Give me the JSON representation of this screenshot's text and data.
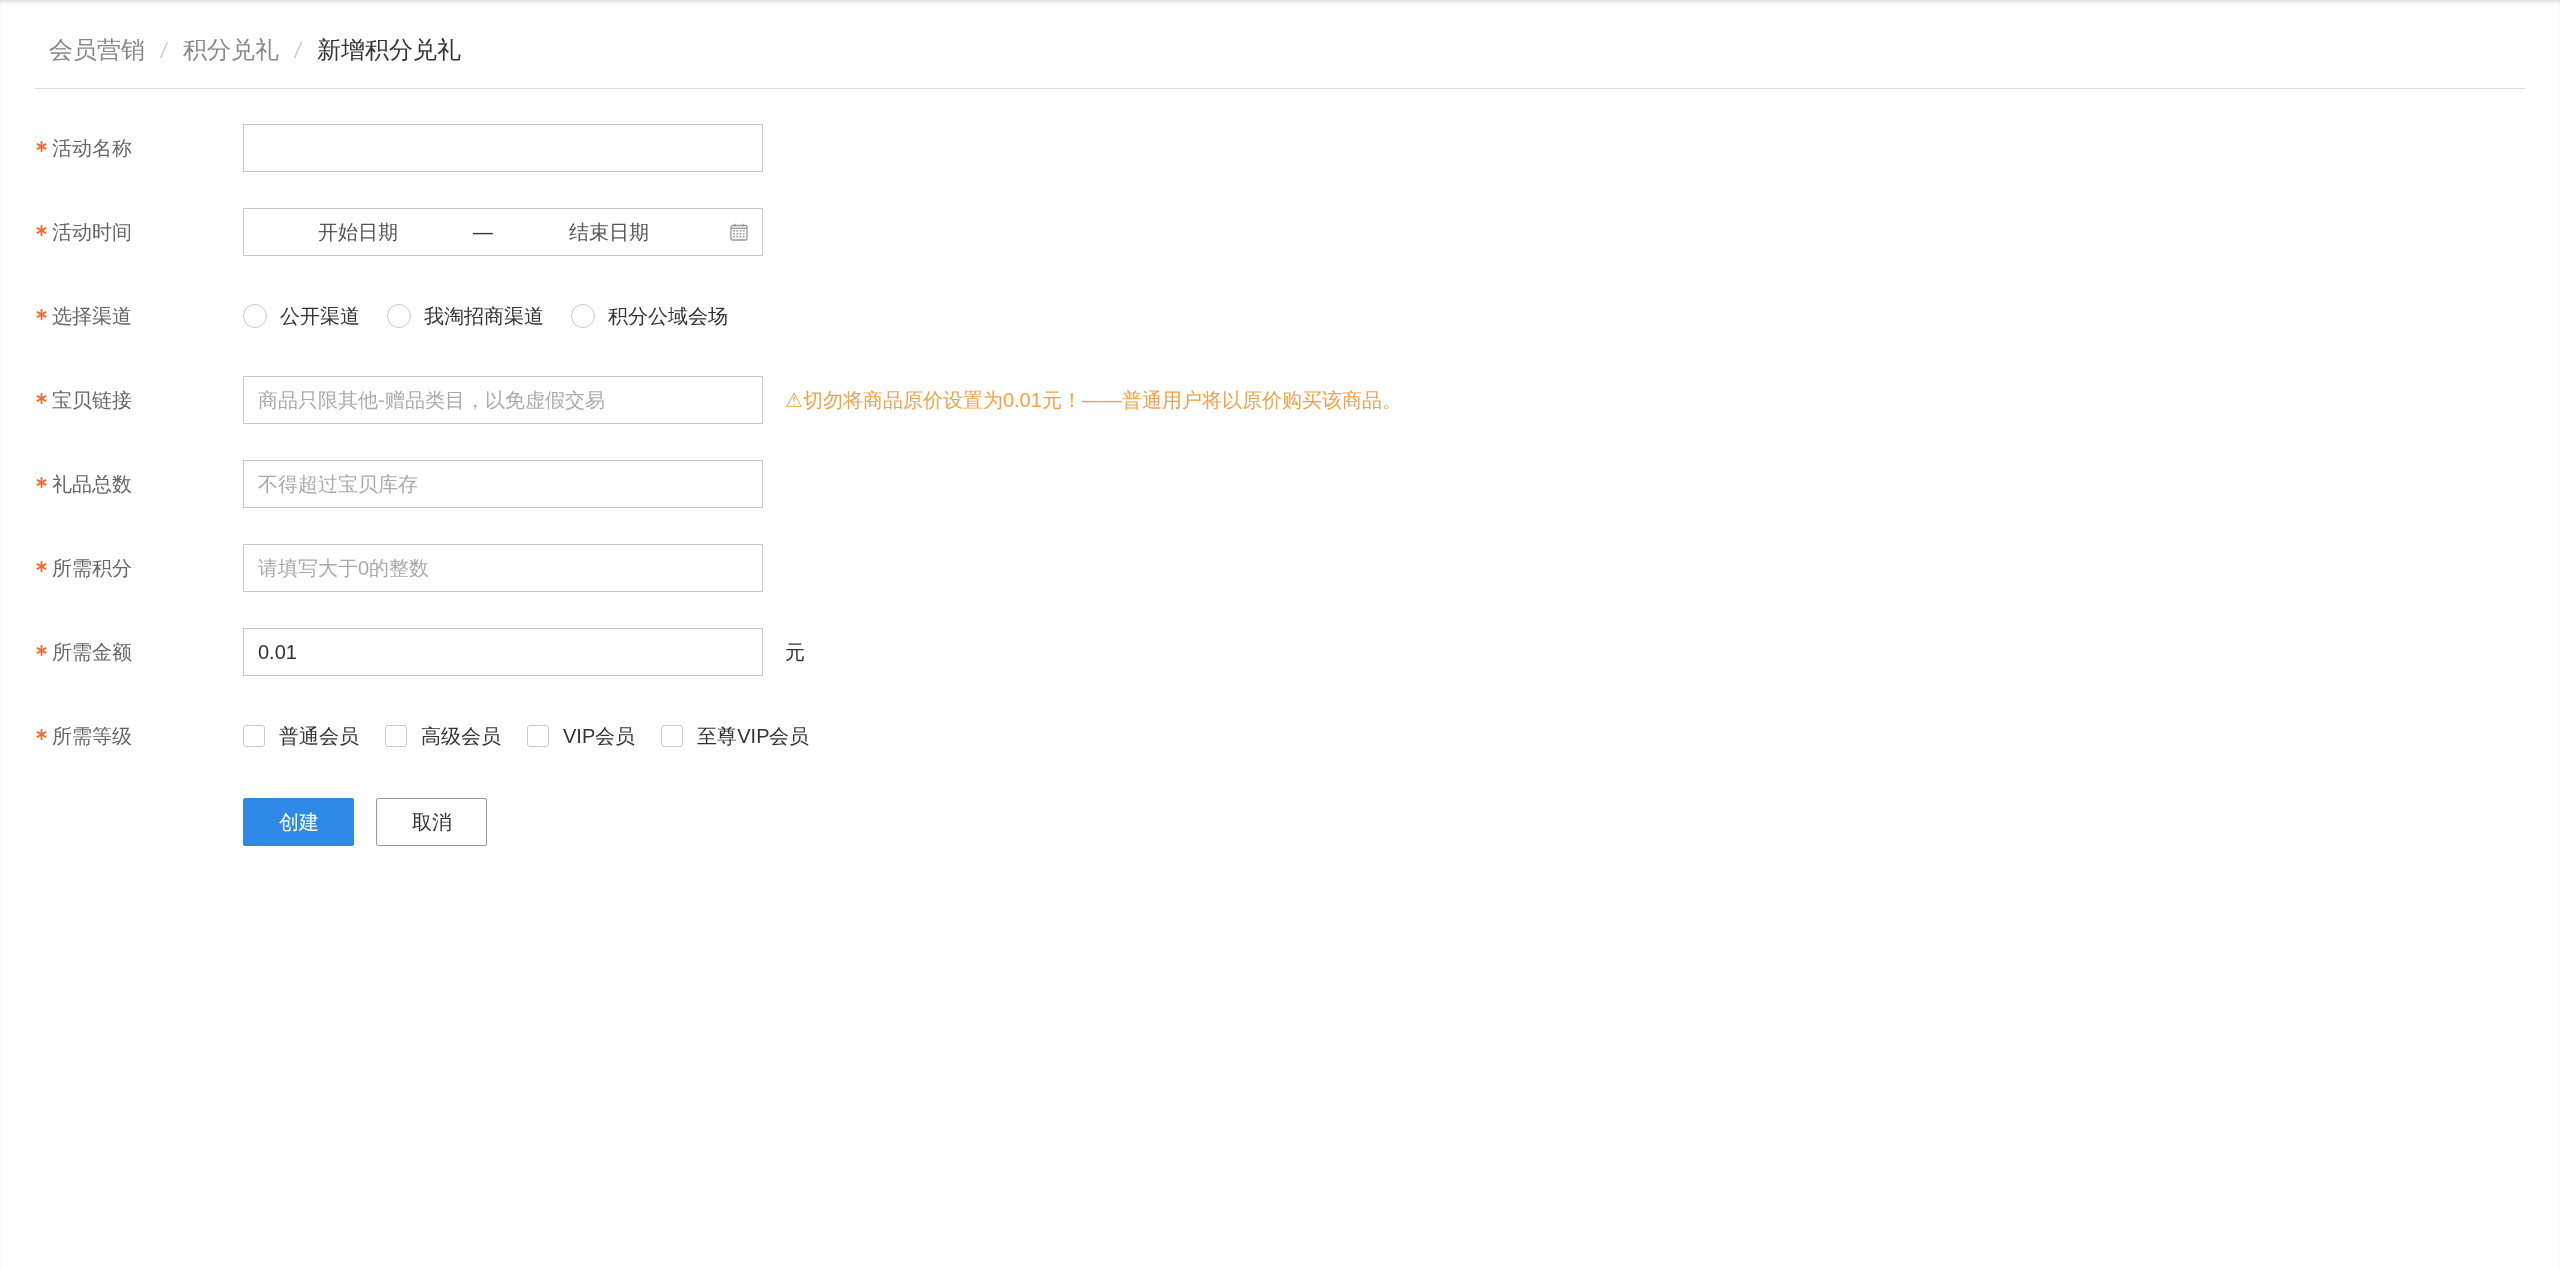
{
  "breadcrumb": [
    {
      "label": "会员营销",
      "current": false
    },
    {
      "label": "积分兑礼",
      "current": false
    },
    {
      "label": "新增积分兑礼",
      "current": true
    }
  ],
  "form": {
    "fields": [
      {
        "kind": "text",
        "label": "活动名称",
        "required": true
      },
      {
        "kind": "date_range",
        "label": "活动时间",
        "required": true,
        "start_placeholder": "开始日期",
        "separator": "—",
        "end_placeholder": "结束日期"
      },
      {
        "kind": "radio",
        "label": "选择渠道",
        "required": true,
        "options": [
          {
            "label": "公开渠道",
            "selected": false
          },
          {
            "label": "我淘招商渠道",
            "selected": false
          },
          {
            "label": "积分公域会场",
            "selected": false
          }
        ]
      },
      {
        "kind": "text",
        "label": "宝贝链接",
        "required": true,
        "placeholder": "商品只限其他-赠品类目，以免虚假交易",
        "note": "⚠切勿将商品原价设置为0.01元！——普通用户将以原价购买该商品。"
      },
      {
        "kind": "text",
        "label": "礼品总数",
        "required": true,
        "placeholder": "不得超过宝贝库存"
      },
      {
        "kind": "text",
        "label": "所需积分",
        "required": true,
        "placeholder": "请填写大于0的整数"
      },
      {
        "kind": "text",
        "label": "所需金额",
        "required": true,
        "value": "0.01",
        "suffix": "元"
      },
      {
        "kind": "checkbox",
        "label": "所需等级",
        "required": true,
        "options": [
          {
            "label": "普通会员",
            "checked": false
          },
          {
            "label": "高级会员",
            "checked": false
          },
          {
            "label": "VIP会员",
            "checked": false
          },
          {
            "label": "至尊VIP会员",
            "checked": false
          }
        ]
      }
    ],
    "buttons": [
      {
        "label": "创建",
        "kind": "primary"
      },
      {
        "label": "取消",
        "kind": "default"
      }
    ]
  }
}
